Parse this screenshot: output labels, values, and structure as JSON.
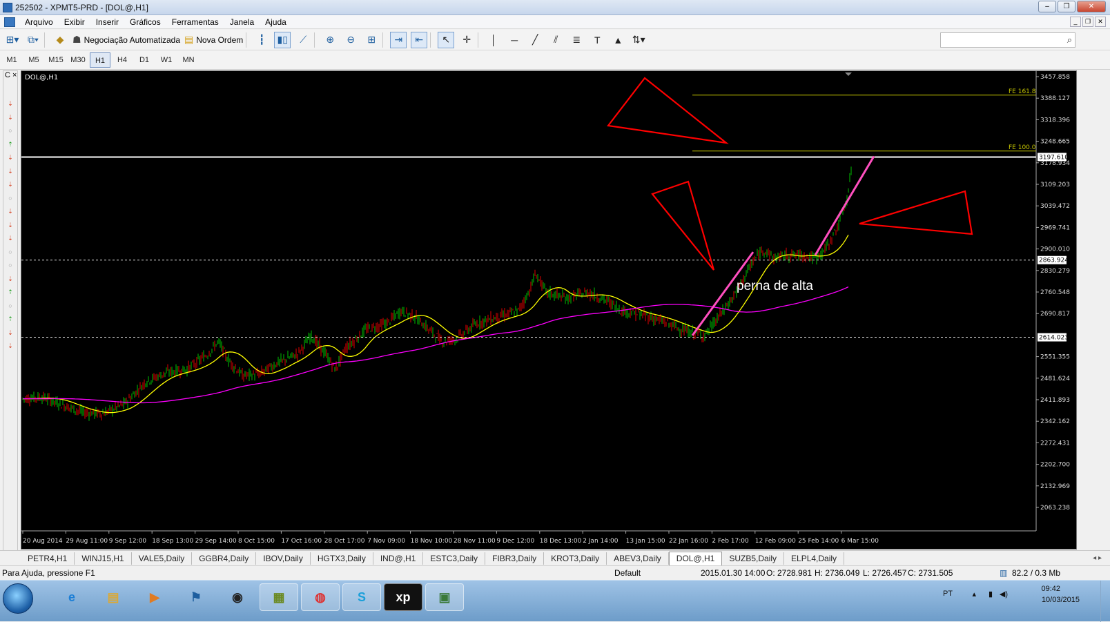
{
  "window": {
    "title": "252502 - XPMT5-PRD - [DOL@,H1]"
  },
  "menu": [
    "Arquivo",
    "Exibir",
    "Inserir",
    "Gráficos",
    "Ferramentas",
    "Janela",
    "Ajuda"
  ],
  "toolbar": {
    "auto_trading_label": "Negociação Automatizada",
    "new_order_label": "Nova Ordem",
    "search_placeholder": ""
  },
  "timeframes": [
    "M1",
    "M5",
    "M15",
    "M30",
    "H1",
    "H4",
    "D1",
    "W1",
    "MN"
  ],
  "active_timeframe": "H1",
  "left_strip": {
    "header": "C ×",
    "footer": "A"
  },
  "chart": {
    "symbol_label": "DOL@,H1",
    "price_axis": [
      "3457.858",
      "3388.127",
      "3318.396",
      "3248.665",
      "3178.934",
      "3109.203",
      "3039.472",
      "2969.741",
      "2900.010",
      "2830.279",
      "2760.548",
      "2690.817",
      "2551.355",
      "2481.624",
      "2411.893",
      "2342.162",
      "2272.431",
      "2202.700",
      "2132.969",
      "2063.238"
    ],
    "price_markers": {
      "current": "3197.610",
      "upper_dotted": "2863.924",
      "lower_dotted": "2614.023"
    },
    "fib_levels": [
      {
        "label": "FE 161.8"
      },
      {
        "label": "FE 100.0"
      }
    ],
    "time_axis": [
      "20 Aug 2014",
      "29 Aug 11:00",
      "9 Sep 12:00",
      "18 Sep 13:00",
      "29 Sep 14:00",
      "8 Oct 15:00",
      "17 Oct 16:00",
      "28 Oct 17:00",
      "7 Nov 09:00",
      "18 Nov 10:00",
      "28 Nov 11:00",
      "9 Dec 12:00",
      "18 Dec 13:00",
      "2 Jan 14:00",
      "13 Jan 15:00",
      "22 Jan 16:00",
      "2 Feb 17:00",
      "12 Feb 09:00",
      "25 Feb 14:00",
      "6 Mar 15:00"
    ],
    "annotation": "perna de alta",
    "colors": {
      "background": "#000000",
      "candles_up": "#00c000",
      "candles_down": "#e00000",
      "ma_fast": "#ffff00",
      "ma_slow": "#ff00ff",
      "trend_line": "#ff4fbf",
      "triangles": "#ff0000",
      "fib": "#c8c800"
    }
  },
  "tabs": [
    "PETR4,H1",
    "WINJ15,H1",
    "VALE5,Daily",
    "GGBR4,Daily",
    "IBOV,Daily",
    "HGTX3,Daily",
    "IND@,H1",
    "ESTC3,Daily",
    "FIBR3,Daily",
    "KROT3,Daily",
    "ABEV3,Daily",
    "DOL@,H1",
    "SUZB5,Daily",
    "ELPL4,Daily"
  ],
  "active_tab": "DOL@,H1",
  "status": {
    "help": "Para Ajuda, pressione F1",
    "profile": "Default",
    "datetime": "2015.01.30 14:00",
    "open": "O: 2728.981",
    "high": "H: 2736.049",
    "low": "L: 2726.457",
    "close": "C: 2731.505",
    "traffic": "82.2 / 0.3 Mb"
  },
  "taskbar": {
    "apps": [
      "windows-start",
      "internet-explorer",
      "file-explorer",
      "media-player",
      "flag-app",
      "hp-app",
      "archive-app",
      "chrome",
      "skype",
      "xp",
      "metatrader"
    ],
    "xp_label": "xp",
    "lang": "PT",
    "time": "09:42",
    "date": "10/03/2015"
  }
}
